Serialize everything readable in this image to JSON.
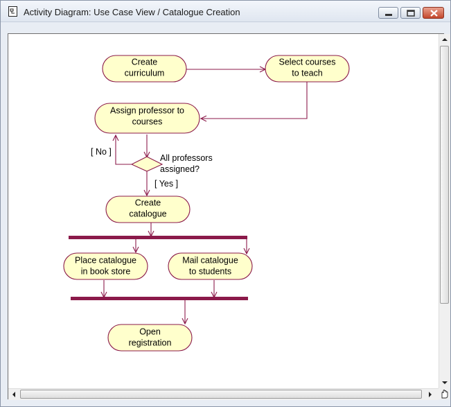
{
  "window": {
    "title": "Activity Diagram: Use Case View / Catalogue Creation",
    "icon": "diagram-document-icon",
    "controls": [
      "minimize-icon",
      "maximize-icon",
      "close-icon"
    ]
  },
  "colors": {
    "activity_fill": "#ffffcc",
    "connector": "#8b1a4a",
    "sync_bar": "#8b1a4a"
  },
  "diagram": {
    "activities": {
      "create_curriculum": [
        "Create",
        "curriculum"
      ],
      "select_courses": [
        "Select courses",
        "to teach"
      ],
      "assign_professor": [
        "Assign professor to",
        "courses"
      ],
      "create_catalogue": [
        "Create",
        "catalogue"
      ],
      "place_catalogue": [
        "Place catalogue",
        "in book store"
      ],
      "mail_catalogue": [
        "Mail catalogue",
        "to students"
      ],
      "open_registration": [
        "Open",
        "registration"
      ]
    },
    "decision": {
      "label": [
        "All professors",
        "assigned?"
      ],
      "no_guard": "[ No ]",
      "yes_guard": "[ Yes ]"
    }
  },
  "scrollbars": {
    "corner_icon": "hand-grip-icon"
  }
}
